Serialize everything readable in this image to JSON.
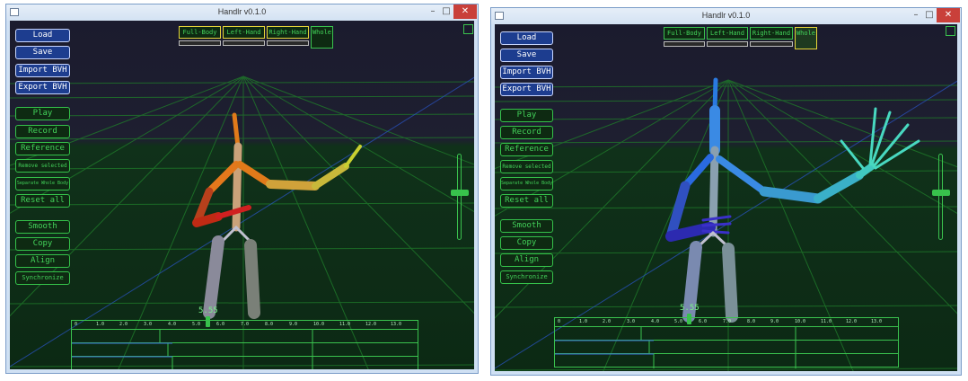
{
  "windows": [
    {
      "title": "Handlr v0.1.0",
      "buttons_primary": [
        "Load",
        "Save",
        "Import BVH",
        "Export BVH"
      ],
      "buttons_edit": [
        "Play",
        "Record",
        "Reference",
        "Remove selected",
        "Separate Whole Body",
        "Reset all"
      ],
      "buttons_tools": [
        "Smooth",
        "Copy",
        "Align",
        "Synchronize"
      ],
      "modes": [
        "Full-Body",
        "Left-Hand",
        "Right-Hand",
        "Whole"
      ],
      "selected_modes": [
        "Full-Body",
        "Left-Hand",
        "Right-Hand"
      ],
      "timeline": {
        "time": "5.55",
        "ticks": [
          "0",
          "1.0",
          "2.0",
          "3.0",
          "4.0",
          "5.0",
          "6.0",
          "7.0",
          "8.0",
          "9.0",
          "10.0",
          "11.0",
          "12.0",
          "13.0"
        ]
      }
    },
    {
      "title": "Handlr v0.1.0",
      "buttons_primary": [
        "Load",
        "Save",
        "Import BVH",
        "Export BVH"
      ],
      "buttons_edit": [
        "Play",
        "Record",
        "Reference",
        "Remove selected",
        "Separate Whole Body",
        "Reset all"
      ],
      "buttons_tools": [
        "Smooth",
        "Copy",
        "Align",
        "Synchronize"
      ],
      "modes": [
        "Full-Body",
        "Left-Hand",
        "Right-Hand",
        "Whole"
      ],
      "selected_modes": [
        "Whole"
      ],
      "timeline": {
        "time": "5.55",
        "ticks": [
          "0",
          "1.0",
          "2.0",
          "3.0",
          "4.0",
          "5.0",
          "6.0",
          "7.0",
          "8.0",
          "9.0",
          "10.0",
          "11.0",
          "12.0",
          "13.0"
        ]
      }
    }
  ],
  "icons": [
    "app-icon",
    "minimize-icon",
    "maximize-icon",
    "close-icon"
  ],
  "colors": {
    "grid": "#1f7a2a",
    "accent_green": "#43d35a",
    "button_blue": "#1d3d8f",
    "close_red": "#c9403a"
  },
  "playback": {
    "slider_level": 0.55
  }
}
